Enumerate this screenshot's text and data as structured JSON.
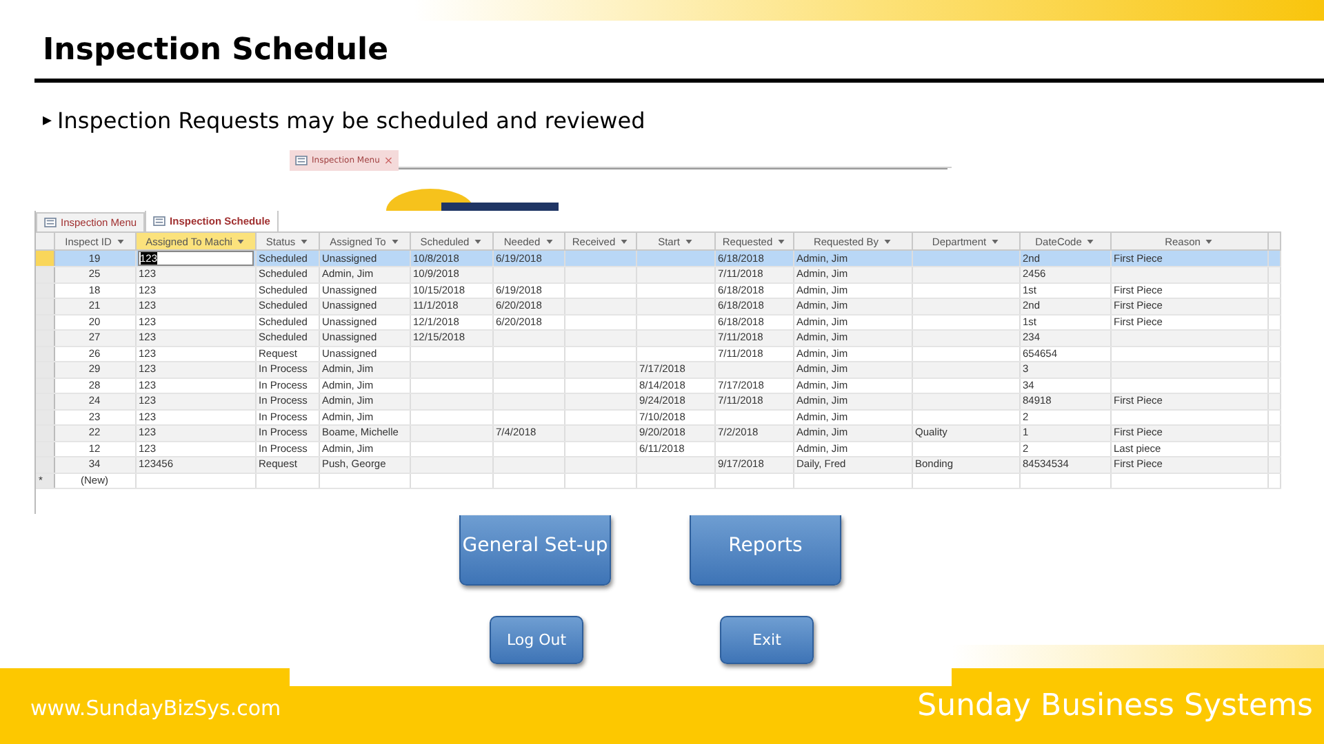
{
  "slide": {
    "title": "Inspection Schedule",
    "bullet_marker": "▸",
    "bullet": "Inspection Requests may be scheduled and reviewed"
  },
  "menu_form": {
    "tab": {
      "label": "Inspection Menu",
      "close": "×"
    },
    "buttons": [
      {
        "label": "General Set-up",
        "kind": "large"
      },
      {
        "label": "Reports",
        "kind": "large"
      },
      {
        "label": "Log Out",
        "kind": "small"
      },
      {
        "label": "Exit",
        "kind": "small"
      }
    ]
  },
  "datasheet": {
    "tabs": [
      {
        "label": "Inspection Menu",
        "selected": false
      },
      {
        "label": "Inspection Schedule",
        "selected": true
      }
    ],
    "columns": [
      "Inspect ID",
      "Assigned To Machi",
      "Status",
      "Assigned To",
      "Scheduled",
      "Needed",
      "Received",
      "Start",
      "Requested",
      "Requested By",
      "Department",
      "DateCode",
      "Reason"
    ],
    "rows": [
      {
        "selected": true,
        "cells": [
          "19",
          "123",
          "Scheduled",
          "Unassigned",
          "10/8/2018",
          "6/19/2018",
          "",
          "",
          "6/18/2018",
          "Admin, Jim",
          "",
          "2nd",
          "First Piece"
        ]
      },
      {
        "selected": false,
        "cells": [
          "25",
          "123",
          "Scheduled",
          "Admin, Jim",
          "10/9/2018",
          "",
          "",
          "",
          "7/11/2018",
          "Admin, Jim",
          "",
          "2456",
          ""
        ]
      },
      {
        "selected": false,
        "cells": [
          "18",
          "123",
          "Scheduled",
          "Unassigned",
          "10/15/2018",
          "6/19/2018",
          "",
          "",
          "6/18/2018",
          "Admin, Jim",
          "",
          "1st",
          "First Piece"
        ]
      },
      {
        "selected": false,
        "cells": [
          "21",
          "123",
          "Scheduled",
          "Unassigned",
          "11/1/2018",
          "6/20/2018",
          "",
          "",
          "6/18/2018",
          "Admin, Jim",
          "",
          "2nd",
          "First Piece"
        ]
      },
      {
        "selected": false,
        "cells": [
          "20",
          "123",
          "Scheduled",
          "Unassigned",
          "12/1/2018",
          "6/20/2018",
          "",
          "",
          "6/18/2018",
          "Admin, Jim",
          "",
          "1st",
          "First Piece"
        ]
      },
      {
        "selected": false,
        "cells": [
          "27",
          "123",
          "Scheduled",
          "Unassigned",
          "12/15/2018",
          "",
          "",
          "",
          "7/11/2018",
          "Admin, Jim",
          "",
          "234",
          ""
        ]
      },
      {
        "selected": false,
        "cells": [
          "26",
          "123",
          "Request",
          "Unassigned",
          "",
          "",
          "",
          "",
          "7/11/2018",
          "Admin, Jim",
          "",
          "654654",
          ""
        ]
      },
      {
        "selected": false,
        "cells": [
          "29",
          "123",
          "In Process",
          "Admin, Jim",
          "",
          "",
          "",
          "7/17/2018",
          "",
          "Admin, Jim",
          "",
          "3",
          ""
        ]
      },
      {
        "selected": false,
        "cells": [
          "28",
          "123",
          "In Process",
          "Admin, Jim",
          "",
          "",
          "",
          "8/14/2018",
          "7/17/2018",
          "Admin, Jim",
          "",
          "34",
          ""
        ]
      },
      {
        "selected": false,
        "cells": [
          "24",
          "123",
          "In Process",
          "Admin, Jim",
          "",
          "",
          "",
          "9/24/2018",
          "7/11/2018",
          "Admin, Jim",
          "",
          "84918",
          "First Piece"
        ]
      },
      {
        "selected": false,
        "cells": [
          "23",
          "123",
          "In Process",
          "Admin, Jim",
          "",
          "",
          "",
          "7/10/2018",
          "",
          "Admin, Jim",
          "",
          "2",
          ""
        ]
      },
      {
        "selected": false,
        "cells": [
          "22",
          "123",
          "In Process",
          "Boame, Michelle",
          "",
          "7/4/2018",
          "",
          "9/20/2018",
          "7/2/2018",
          "Admin, Jim",
          "Quality",
          "1",
          "First Piece"
        ]
      },
      {
        "selected": false,
        "cells": [
          "12",
          "123",
          "In Process",
          "Admin, Jim",
          "",
          "",
          "",
          "6/11/2018",
          "",
          "Admin, Jim",
          "",
          "2",
          "Last piece"
        ]
      },
      {
        "selected": false,
        "cells": [
          "34",
          "123456",
          "Request",
          "Push, George",
          "",
          "",
          "",
          "",
          "9/17/2018",
          "Daily, Fred",
          "Bonding",
          "84534534",
          "First Piece"
        ]
      }
    ],
    "new_row": {
      "marker": "*",
      "label": "(New)"
    }
  },
  "footer": {
    "url": "www.SundayBizSys.com",
    "company": "Sunday Business Systems"
  }
}
